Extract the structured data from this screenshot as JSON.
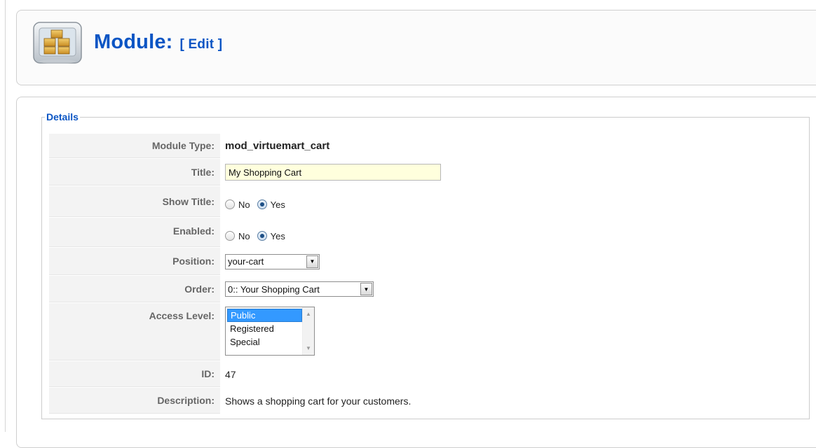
{
  "header": {
    "title": "Module:",
    "subtitle": "[ Edit ]"
  },
  "details": {
    "legend": "Details",
    "module_type": {
      "label": "Module Type:",
      "value": "mod_virtuemart_cart"
    },
    "title": {
      "label": "Title:",
      "value": "My Shopping Cart"
    },
    "show_title": {
      "label": "Show Title:",
      "options": [
        "No",
        "Yes"
      ],
      "selected": "Yes"
    },
    "enabled": {
      "label": "Enabled:",
      "options": [
        "No",
        "Yes"
      ],
      "selected": "Yes"
    },
    "position": {
      "label": "Position:",
      "value": "your-cart"
    },
    "order": {
      "label": "Order:",
      "value": "0:: Your Shopping Cart"
    },
    "access_level": {
      "label": "Access Level:",
      "options": [
        "Public",
        "Registered",
        "Special"
      ],
      "selected": "Public"
    },
    "id": {
      "label": "ID:",
      "value": "47"
    },
    "description": {
      "label": "Description:",
      "value": "Shows a shopping cart for your customers."
    }
  },
  "colors": {
    "title_blue": "#0b55c4",
    "input_bg": "#ffffdd",
    "selected_option": "#3399ff"
  },
  "icons": [
    "module-box-icon",
    "dropdown-arrow-icon",
    "scroll-up-icon",
    "scroll-down-icon"
  ]
}
